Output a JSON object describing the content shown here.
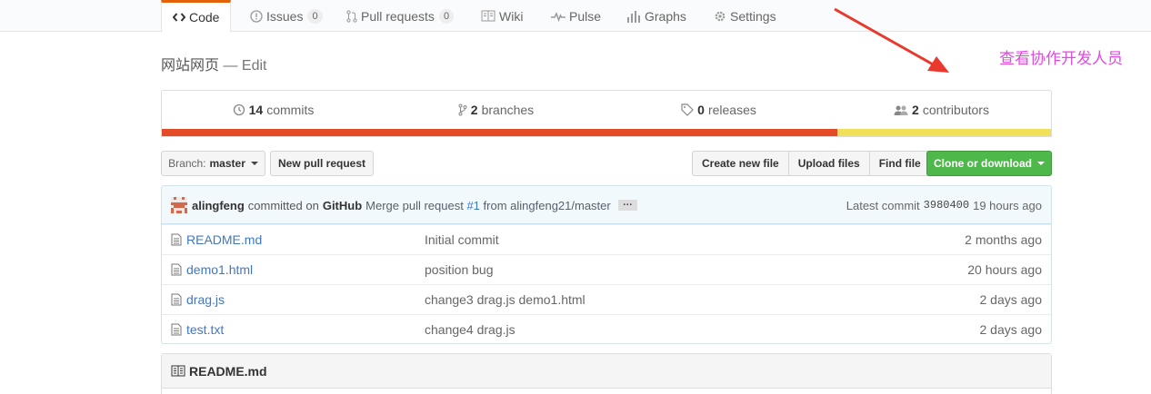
{
  "nav": {
    "tabs": [
      {
        "label": "Code",
        "icon": "code-icon",
        "selected": true
      },
      {
        "label": "Issues",
        "icon": "issue-icon",
        "count": "0"
      },
      {
        "label": "Pull requests",
        "icon": "pull-request-icon",
        "count": "0"
      },
      {
        "label": "Wiki",
        "icon": "book-icon"
      },
      {
        "label": "Pulse",
        "icon": "pulse-icon"
      },
      {
        "label": "Graphs",
        "icon": "graph-icon"
      },
      {
        "label": "Settings",
        "icon": "gear-icon"
      }
    ]
  },
  "annotation": {
    "text": "查看协作开发人员",
    "color": "#e04ae0",
    "arrow_color": "#e8392c"
  },
  "repo": {
    "title": "网站网页",
    "separator": "—",
    "edit_label": "Edit"
  },
  "summary": {
    "commits": {
      "count": "14",
      "label": "commits"
    },
    "branches": {
      "count": "2",
      "label": "branches"
    },
    "releases": {
      "count": "0",
      "label": "releases"
    },
    "contributors": {
      "count": "2",
      "label": "contributors"
    }
  },
  "languages": [
    {
      "color": "#e34c26",
      "percent": 76
    },
    {
      "color": "#f1e05a",
      "percent": 24
    }
  ],
  "toolbar": {
    "branch_prefix": "Branch:",
    "branch_name": "master",
    "new_pr": "New pull request",
    "create_file": "Create new file",
    "upload_files": "Upload files",
    "find_file": "Find file",
    "clone": "Clone or download"
  },
  "latest_commit": {
    "author": "alingfeng",
    "committed_on": "committed on",
    "platform": "GitHub",
    "message_prefix": "Merge pull request",
    "pr_link": "#1",
    "message_suffix": "from alingfeng21/master",
    "ellipsis": "…",
    "latest_label": "Latest commit",
    "sha": "3980400",
    "age": "19 hours ago"
  },
  "files": [
    {
      "name": "README.md",
      "message": "Initial commit",
      "age": "2 months ago"
    },
    {
      "name": "demo1.html",
      "message": "position bug",
      "age": "20 hours ago"
    },
    {
      "name": "drag.js",
      "message": "change3 drag.js demo1.html",
      "age": "2 days ago"
    },
    {
      "name": "test.txt",
      "message": "change4 drag.js",
      "age": "2 days ago"
    }
  ],
  "readme": {
    "title": "README.md"
  }
}
